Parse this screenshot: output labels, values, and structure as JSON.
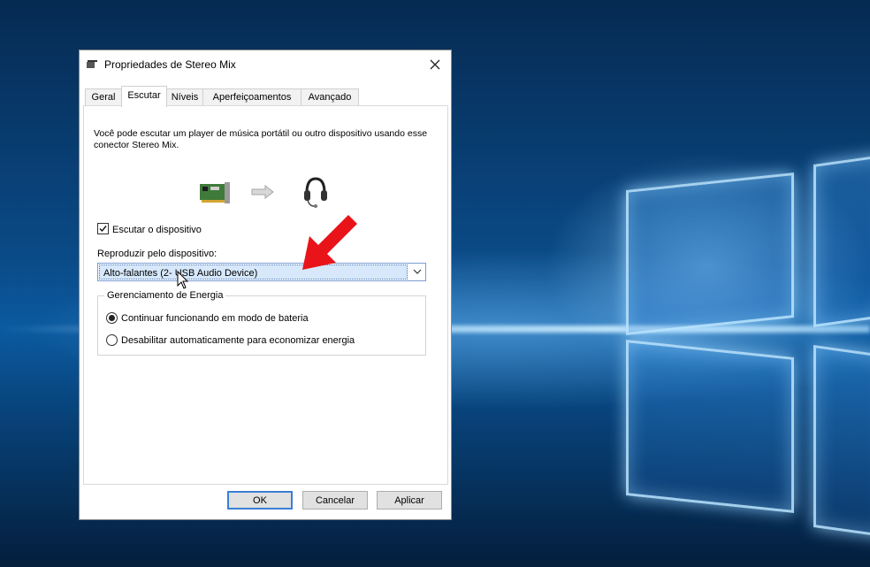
{
  "dialog": {
    "title": "Propriedades de Stereo Mix",
    "tabs": [
      {
        "label": "Geral"
      },
      {
        "label": "Escutar",
        "active": true
      },
      {
        "label": "Níveis"
      },
      {
        "label": "Aperfeiçoamentos"
      },
      {
        "label": "Avançado"
      }
    ],
    "description": "Você pode escutar um player de música portátil ou outro dispositivo usando esse conector Stereo Mix.",
    "listen_checkbox": {
      "label": "Escutar o dispositivo",
      "checked": true
    },
    "playback": {
      "label": "Reproduzir pelo dispositivo:",
      "selected": "Alto-falantes (2- USB Audio Device)"
    },
    "power": {
      "legend": "Gerenciamento de Energia",
      "options": [
        {
          "label": "Continuar funcionando em modo de bateria",
          "selected": true
        },
        {
          "label": "Desabilitar automaticamente para economizar energia",
          "selected": false
        }
      ]
    },
    "buttons": {
      "ok": "OK",
      "cancel": "Cancelar",
      "apply": "Aplicar"
    }
  },
  "colors": {
    "annotation_arrow": "#e8141a",
    "default_button_border": "#3c7fd6",
    "desktop_blue": "#0b5aa0"
  }
}
